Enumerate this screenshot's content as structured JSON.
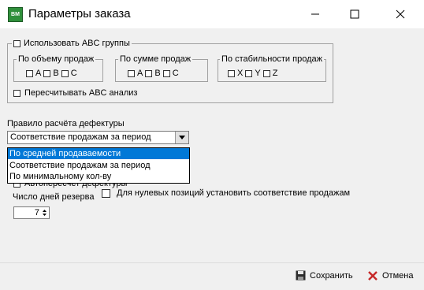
{
  "window": {
    "title": "Параметры заказа",
    "icon_text": "BM"
  },
  "abc": {
    "use_label": "Использовать ABC группы",
    "groups": [
      {
        "title": "По объему продаж",
        "items": [
          "A",
          "B",
          "C"
        ]
      },
      {
        "title": "По сумме продаж",
        "items": [
          "A",
          "B",
          "C"
        ]
      },
      {
        "title": "По стабильности продаж",
        "items": [
          "X",
          "Y",
          "Z"
        ]
      }
    ],
    "recalc_label": "Пересчитывать ABC анализ"
  },
  "rule": {
    "label": "Правило расчёта дефектуры",
    "selected": "Соответствие продажам за период",
    "options": [
      "По средней продаваемости",
      "Соответствие продажам за период",
      "По минимальному кол-ву"
    ],
    "highlighted_index": 0
  },
  "autocalc_label": "Автопересчет дефектуры",
  "zero_positions_label": "Для нулевых позиций установить соответствие продажам",
  "reserve": {
    "label": "Число дней резерва",
    "value": "7"
  },
  "buttons": {
    "save": "Сохранить",
    "cancel": "Отмена"
  },
  "colors": {
    "selection": "#0078d7"
  }
}
